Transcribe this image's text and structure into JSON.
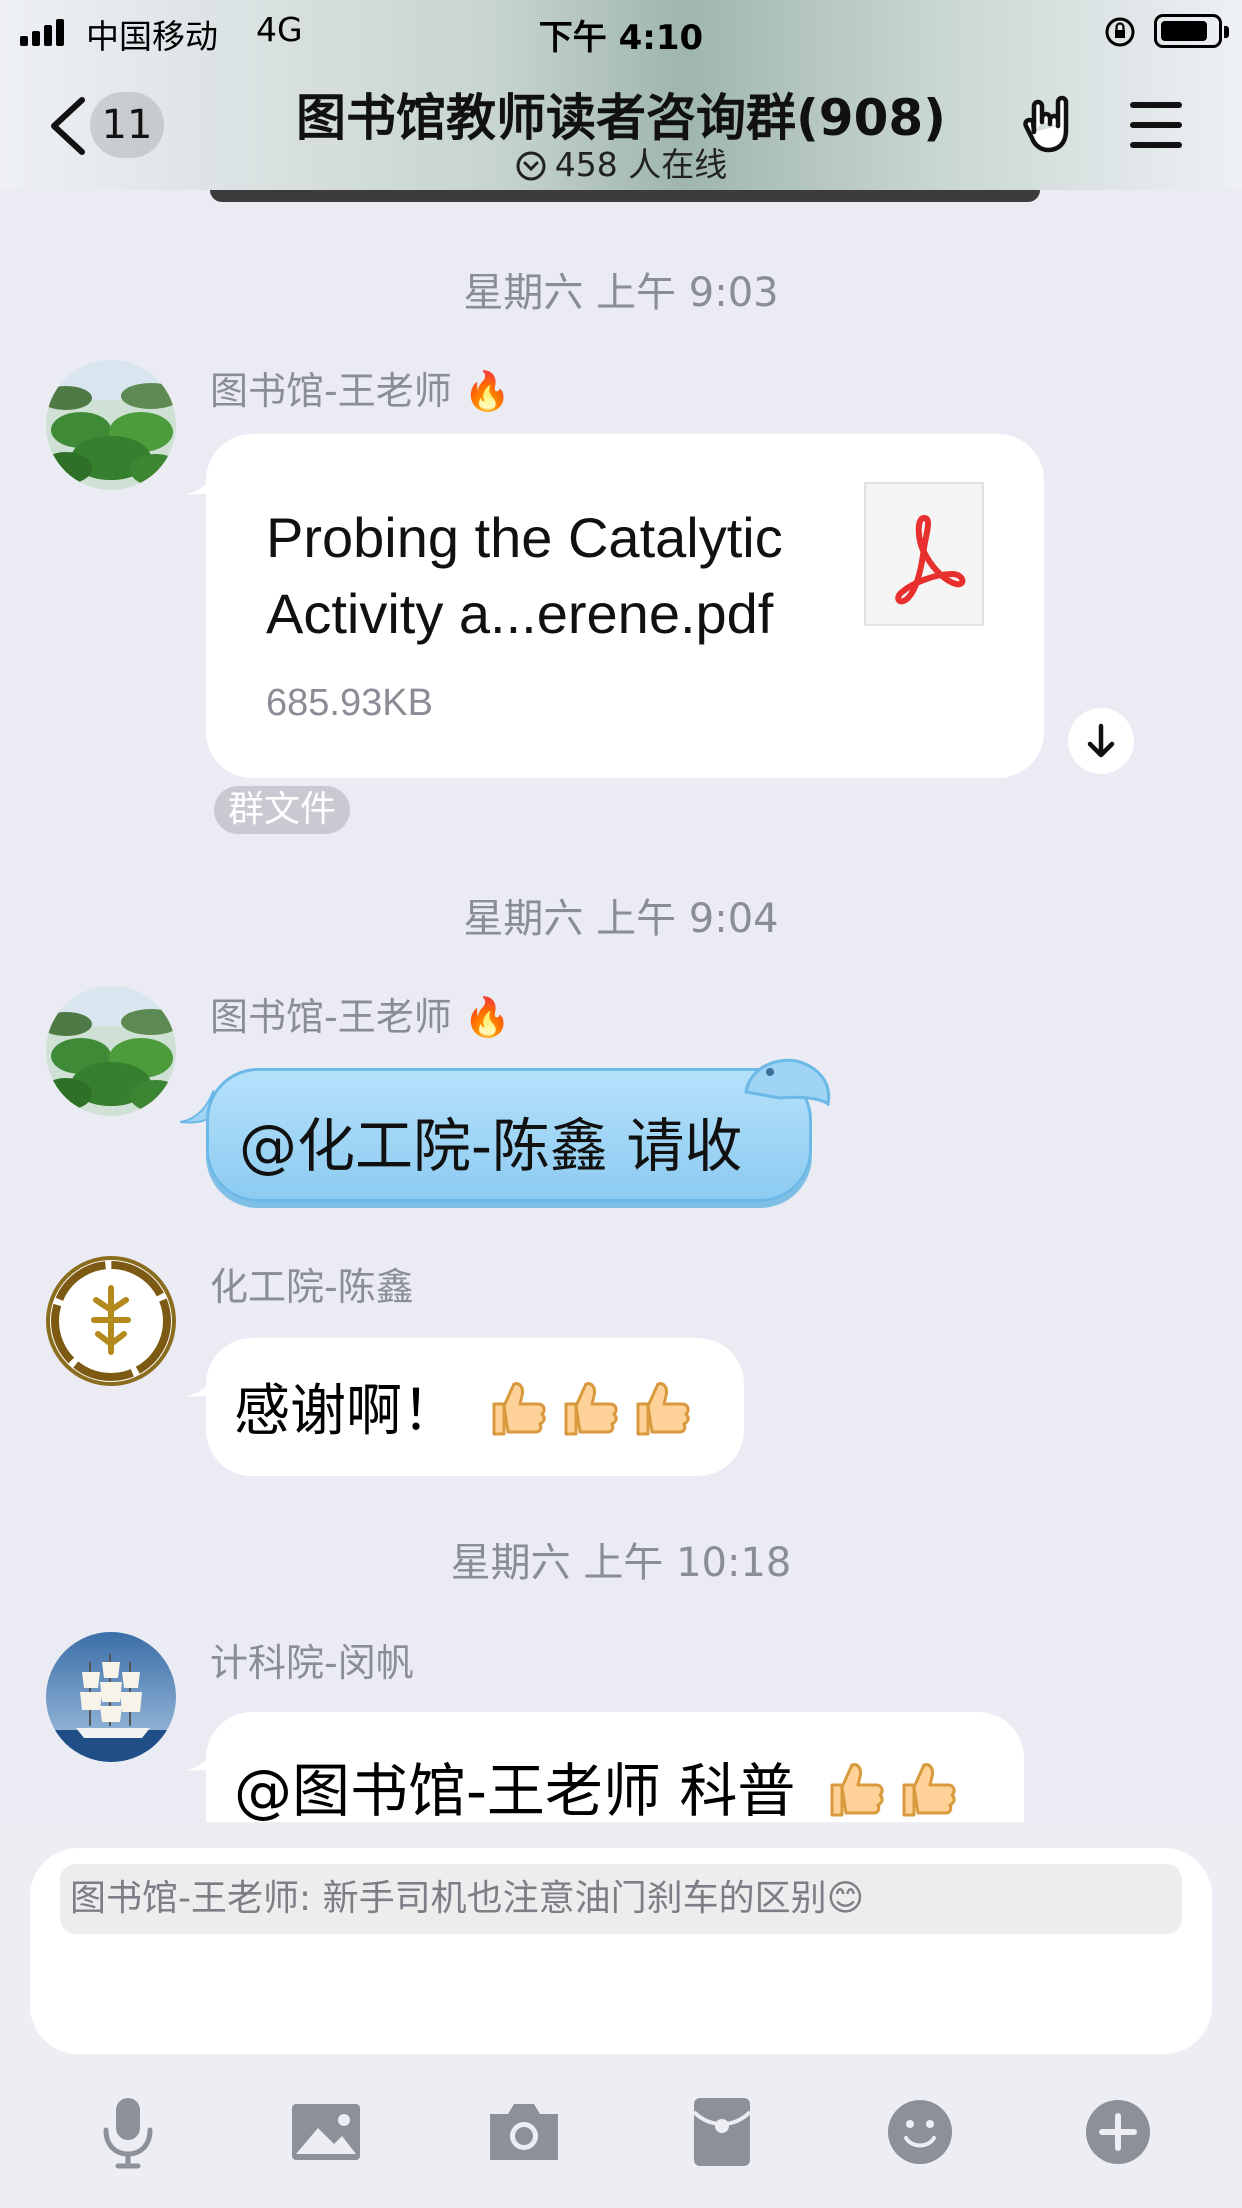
{
  "status_bar": {
    "carrier": "中国移动",
    "network": "4G",
    "time": "下午 4:10"
  },
  "header": {
    "unread_count": "11",
    "title": "图书馆教师读者咨询群(908)",
    "online_text": "458 人在线"
  },
  "messages": [
    {
      "timestamp": "星期六 上午 9:03",
      "sender": "图书馆-王老师",
      "sender_badge": "🔥",
      "type": "file",
      "file_name": "Probing the Catalytic Activity a...erene.pdf",
      "file_size": "685.93KB",
      "tag": "群文件"
    },
    {
      "timestamp": "星期六 上午 9:04",
      "sender": "图书馆-王老师",
      "sender_badge": "🔥",
      "type": "text",
      "text": "@化工院-陈鑫 请收"
    },
    {
      "sender": "化工院-陈鑫",
      "type": "text",
      "text": "感谢啊！"
    },
    {
      "timestamp": "星期六 上午 10:18",
      "sender": "计科院-闵帆",
      "type": "text",
      "text": "@图书馆-王老师 科普"
    }
  ],
  "input": {
    "quote": "图书馆-王老师: 新手司机也注意油门刹车的区别😊"
  },
  "toolbar": {
    "icons": [
      "microphone-icon",
      "image-icon",
      "camera-icon",
      "red-packet-icon",
      "emoji-icon",
      "plus-icon"
    ]
  },
  "colors": {
    "background": "#eaebf3",
    "blue_bubble": "#9fd4f5",
    "timestamp": "#8a8c96"
  }
}
